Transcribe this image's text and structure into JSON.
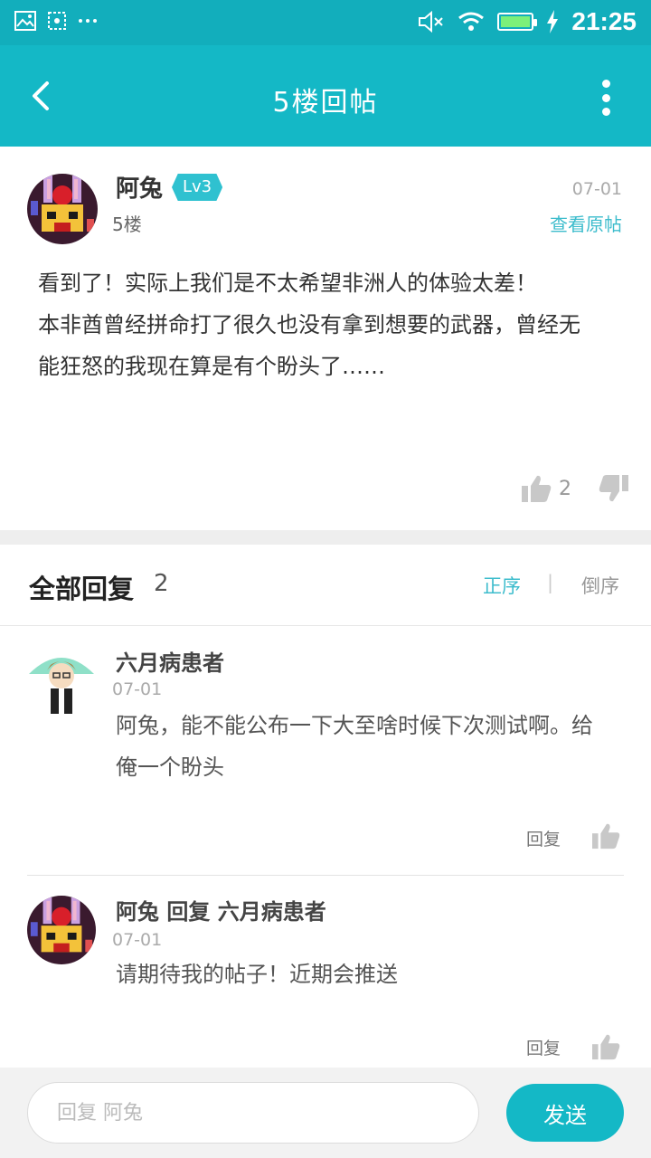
{
  "colors": {
    "accent": "#14b8c6",
    "statusbar": "#12aebc",
    "link": "#3cbccc",
    "band": "#eeeeee"
  },
  "status_bar": {
    "time": "21:25",
    "icons": [
      "image-icon",
      "screenshot-icon",
      "more-dots-icon",
      "mute-icon",
      "wifi-icon",
      "battery-icon",
      "charging-icon"
    ]
  },
  "appbar": {
    "title": "5楼回帖"
  },
  "post": {
    "author": "阿兔",
    "level": "Lv3",
    "floor": "5楼",
    "date": "07-01",
    "view_original": "查看原帖",
    "body": [
      "看到了！实际上我们是不太希望非洲人的体验太差！",
      "本非酋曾经拼命打了很久也没有拿到想要的武器，曾经无能狂怒的我现在算是有个盼头了……"
    ],
    "likes": "2"
  },
  "replies": {
    "title": "全部回复",
    "count": "2",
    "sort_asc": "正序",
    "sort_sep": "|",
    "sort_desc": "倒序",
    "items": [
      {
        "name": "六月病患者",
        "date": "07-01",
        "text": "阿兔，能不能公布一下大至啥时候下次测试啊。给俺一个盼头",
        "reply_label": "回复"
      },
      {
        "name": "阿兔 回复 六月病患者",
        "date": "07-01",
        "text": "请期待我的帖子！近期会推送",
        "reply_label": "回复"
      }
    ]
  },
  "composer": {
    "placeholder": "回复 阿兔",
    "send": "发送"
  }
}
